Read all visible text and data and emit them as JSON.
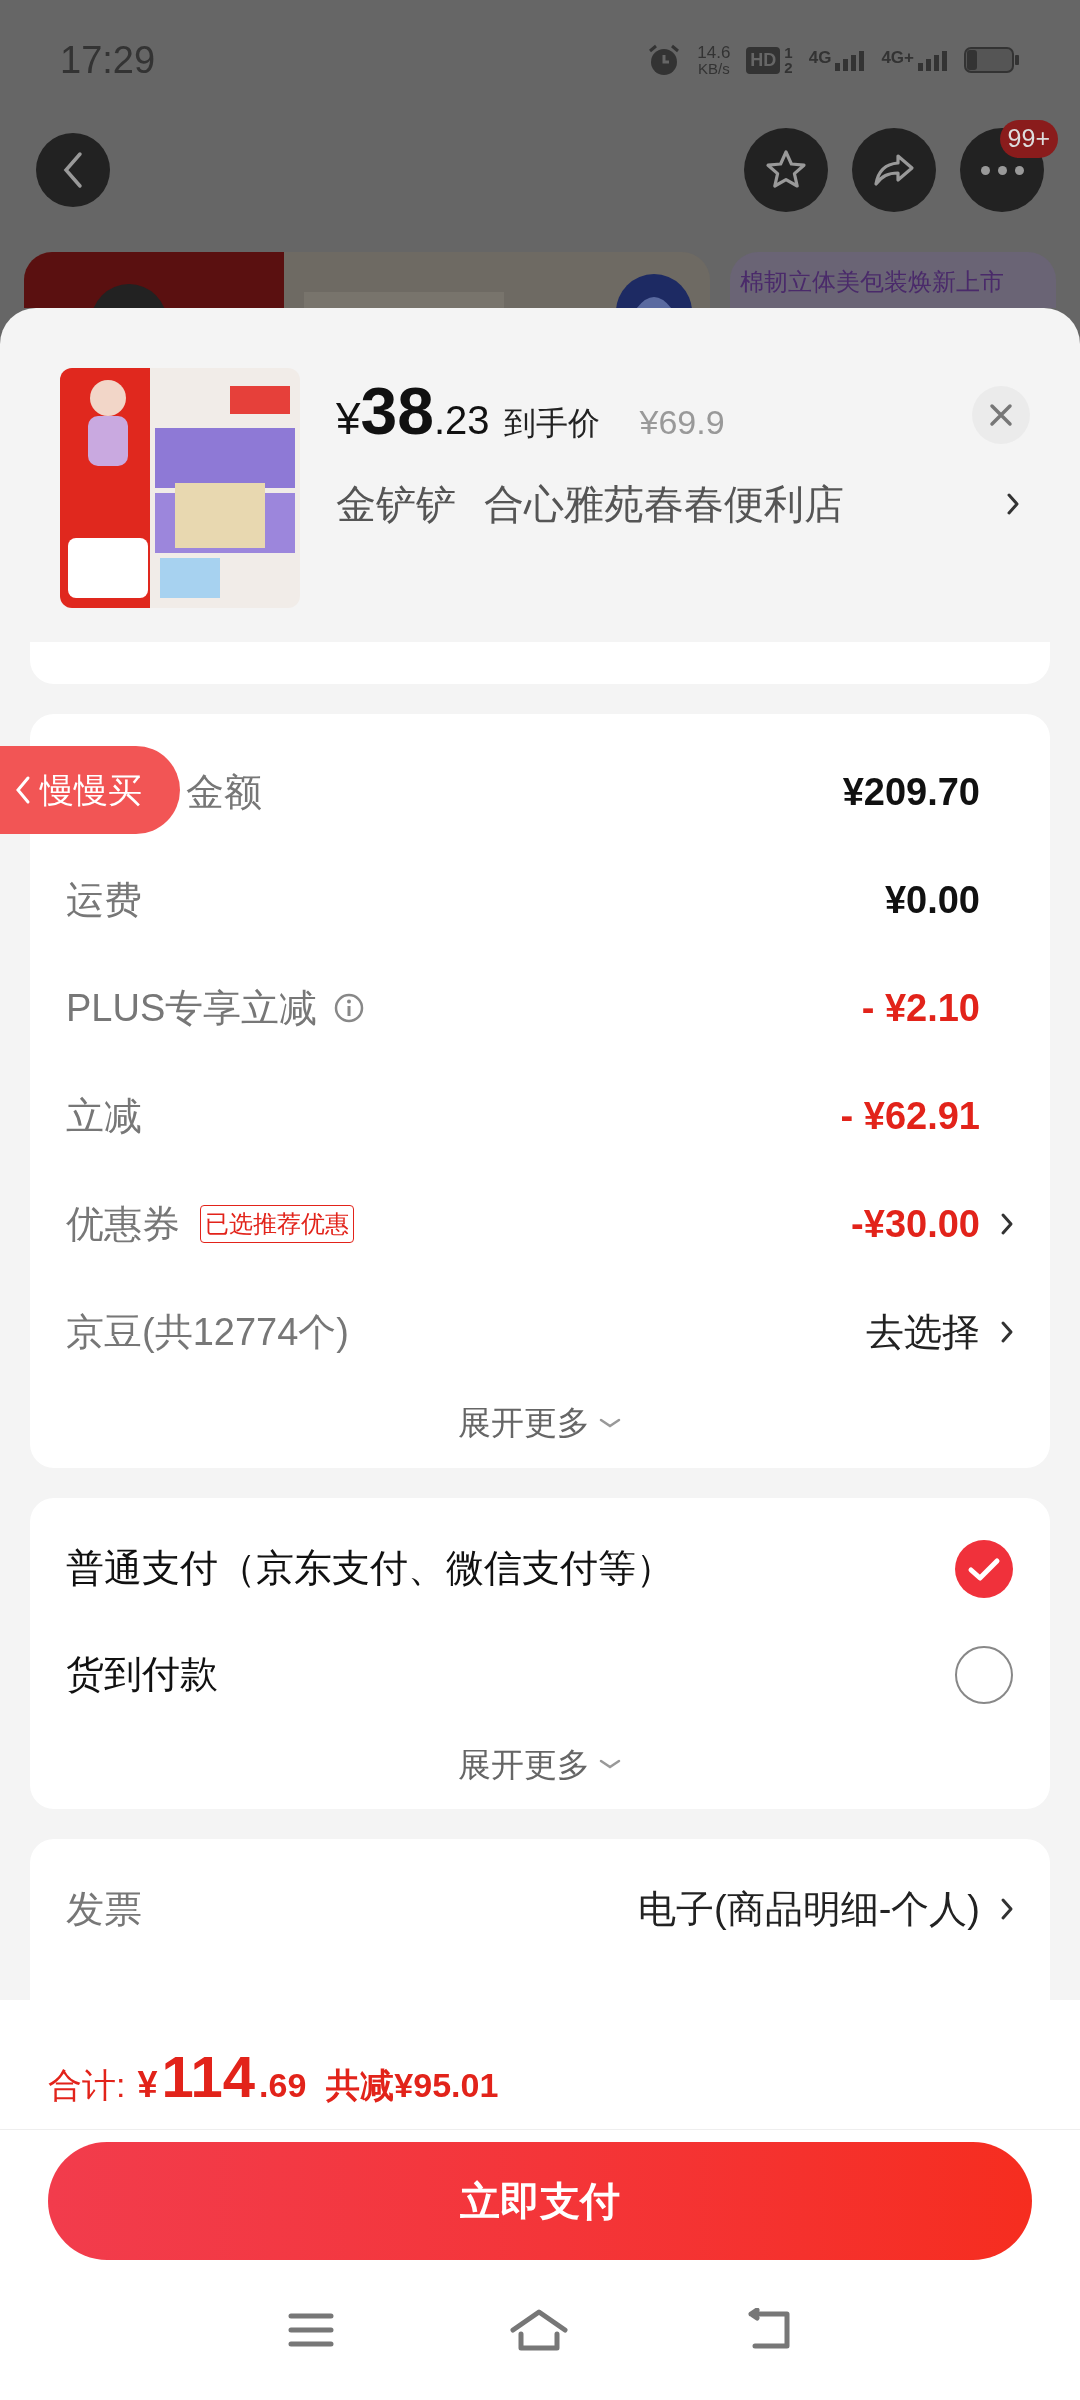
{
  "status_bar": {
    "time": "17:29",
    "speed": "14.6",
    "speed_unit": "KB/s",
    "hd": "HD",
    "hd_sims": [
      "1",
      "2"
    ],
    "networks": [
      "4G",
      "4G+"
    ]
  },
  "header": {
    "more_badge": "99+"
  },
  "banner": {
    "promo_text": "棉韧立体美包装焕新上市"
  },
  "product": {
    "price_symbol": "¥",
    "price_int": "38",
    "price_dec": ".23",
    "price_label": "到手价",
    "original_price": "¥69.9",
    "shop_tag": "金铲铲",
    "shop_name": "合心雅苑春春便利店"
  },
  "floating_pill": {
    "label": "慢慢买"
  },
  "summary": {
    "rows": [
      {
        "label": "金额",
        "value": "¥209.70",
        "kind": "amount",
        "info": false,
        "chevron": false
      },
      {
        "label": "运费",
        "value": "¥0.00",
        "kind": "amount",
        "info": false,
        "chevron": false
      },
      {
        "label": "PLUS专享立减",
        "value": "- ¥2.10",
        "kind": "discount",
        "info": true,
        "chevron": false
      },
      {
        "label": "立减",
        "value": "- ¥62.91",
        "kind": "discount",
        "info": false,
        "chevron": false
      },
      {
        "label": "优惠券",
        "tag": "已选推荐优惠",
        "value": "-¥30.00",
        "kind": "discount",
        "info": false,
        "chevron": true
      },
      {
        "label": "京豆(共12774个)",
        "value": "去选择",
        "kind": "link",
        "info": false,
        "chevron": true
      }
    ],
    "expand": "展开更多"
  },
  "payment": {
    "options": [
      {
        "label": "普通支付（京东支付、微信支付等）",
        "selected": true
      },
      {
        "label": "货到付款",
        "selected": false
      }
    ],
    "expand": "展开更多"
  },
  "invoice": {
    "label": "发票",
    "value": "电子(商品明细-个人)"
  },
  "footer": {
    "total_label": "合计:",
    "symbol": "¥",
    "int": "114",
    "dec": ".69",
    "saved": "共减¥95.01",
    "pay_button": "立即支付"
  }
}
